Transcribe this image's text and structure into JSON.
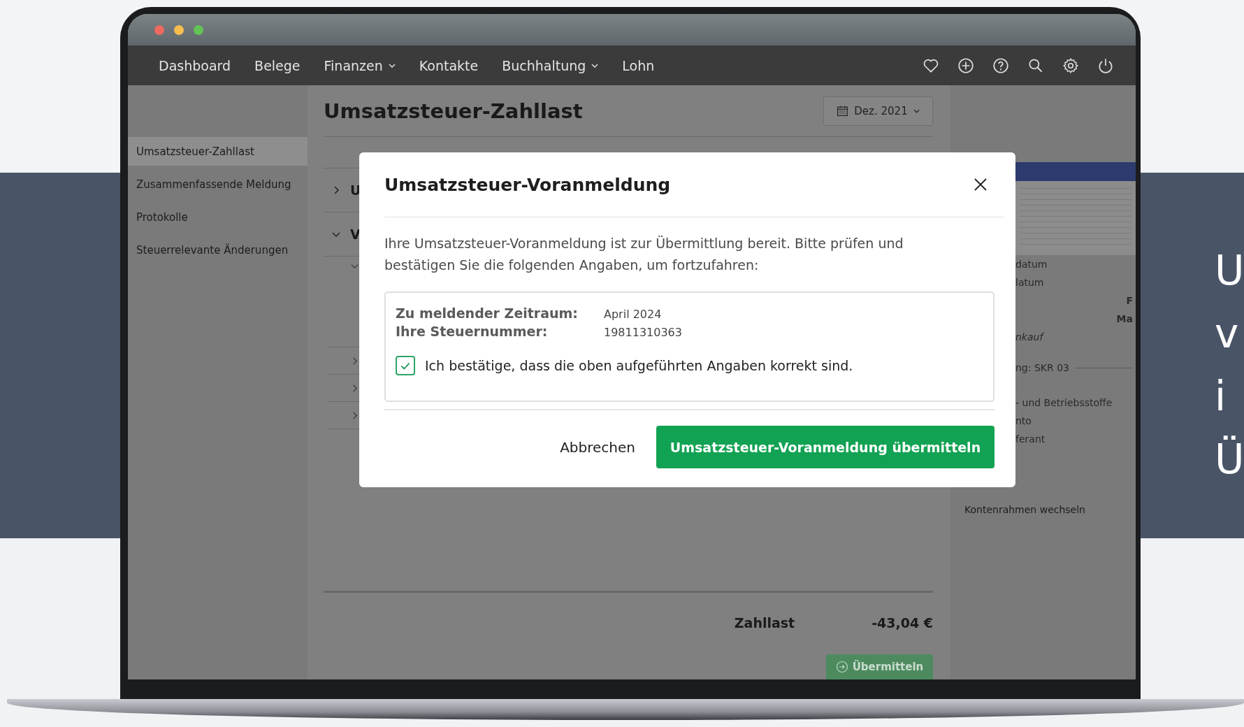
{
  "window": {
    "traffic_lights": [
      {
        "color": "#ee6a5f"
      },
      {
        "color": "#f5be4f"
      },
      {
        "color": "#61c454"
      }
    ]
  },
  "nav": {
    "items": [
      {
        "label": "Dashboard",
        "dropdown": false
      },
      {
        "label": "Belege",
        "dropdown": false
      },
      {
        "label": "Finanzen",
        "dropdown": true
      },
      {
        "label": "Kontakte",
        "dropdown": false
      },
      {
        "label": "Buchhaltung",
        "dropdown": true
      },
      {
        "label": "Lohn",
        "dropdown": false
      }
    ]
  },
  "sidebar": {
    "items": [
      {
        "label": "Umsatzsteuer-Zahllast",
        "selected": true
      },
      {
        "label": "Zusammenfassende Meldung",
        "selected": false
      },
      {
        "label": "Protokolle",
        "selected": false
      },
      {
        "label": "Steuerrelevante Änderungen",
        "selected": false
      }
    ]
  },
  "page": {
    "title": "Umsatzsteuer-Zahllast",
    "period": "Dez. 2021",
    "table": {
      "rows": [
        {
          "label": "U",
          "expanded": false,
          "children": []
        },
        {
          "label": "V",
          "expanded": true,
          "children": [
            {
              "expanded": true
            },
            {
              "expanded": false
            },
            {
              "expanded": false
            },
            {
              "expanded": false
            }
          ]
        }
      ]
    },
    "total": {
      "label": "Zahllast",
      "value": "-43,04 €"
    },
    "submit_button": "Übermitteln"
  },
  "right_panel": {
    "lines": [
      {
        "kind": "plain",
        "text": "datum"
      },
      {
        "kind": "plain",
        "text": "latum"
      },
      {
        "kind": "right",
        "text": "F"
      },
      {
        "kind": "right",
        "text": "Ma"
      },
      {
        "kind": "italic",
        "text": "nkauf"
      },
      {
        "kind": "rule",
        "text": "ng: SKR 03"
      },
      {
        "kind": "plain",
        "text": "- und Betriebsstoffe"
      },
      {
        "kind": "plain",
        "text": "nto"
      },
      {
        "kind": "plain",
        "text": "ferant"
      }
    ],
    "link": "Kontenrahmen wechseln"
  },
  "modal": {
    "title": "Umsatzsteuer-Voranmeldung",
    "text": "Ihre Umsatzsteuer-Voranmeldung ist zur Übermittlung bereit. Bitte prüfen und bestätigen Sie die folgenden Angaben, um fortzufahren:",
    "fields": [
      {
        "label": "Zu meldender Zeitraum:",
        "value": "April 2024"
      },
      {
        "label": "Ihre Steuernummer:",
        "value": "19811310363"
      }
    ],
    "confirm": {
      "label": "Ich bestätige, dass die oben aufgeführten Angaben korrekt sind.",
      "checked": true
    },
    "cancel_button": "Abbrechen",
    "submit_button": "Umsatzsteuer-Voranmeldung übermitteln"
  },
  "side_text": [
    "U",
    "v",
    "i",
    "Ü"
  ]
}
